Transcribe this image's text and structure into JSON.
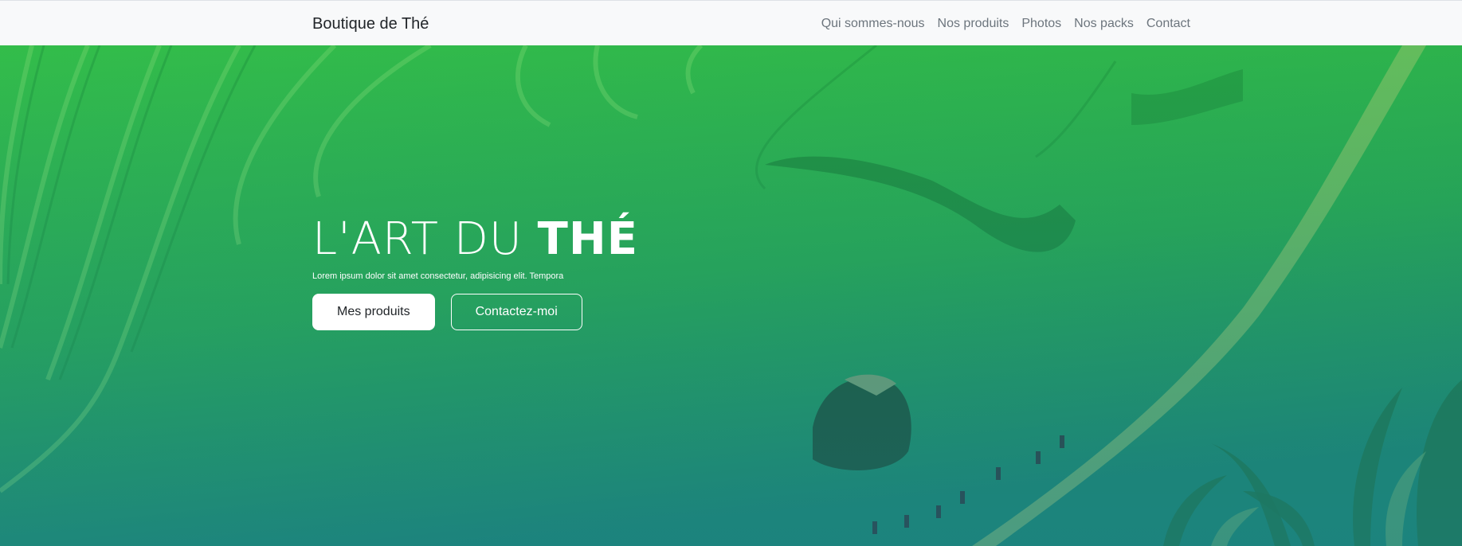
{
  "navbar": {
    "brand": "Boutique de Thé",
    "links": [
      "Qui sommes-nous",
      "Nos produits",
      "Photos",
      "Nos packs",
      "Contact"
    ]
  },
  "hero": {
    "title_light": "L'ART DU ",
    "title_bold": "THÉ",
    "subtitle": "Lorem ipsum dolor sit amet consectetur, adipisicing elit. Tempora",
    "primary_button": "Mes produits",
    "secondary_button": "Contactez-moi",
    "background_description_icon": "rice-terrace-photo"
  },
  "colors": {
    "hero_top": "#2fb84b",
    "hero_bottom": "#1f8f5f",
    "navbar_bg": "#f8f9fa",
    "nav_link": "#6c757d"
  }
}
